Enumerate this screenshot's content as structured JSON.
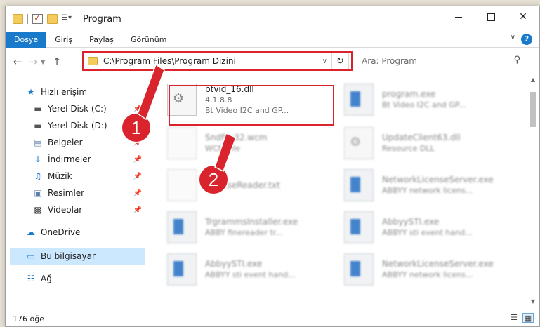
{
  "window": {
    "title": "Program",
    "controls": {
      "minimize": "",
      "maximize": "",
      "close": "✕"
    }
  },
  "ribbon": {
    "tabs": [
      "Dosya",
      "Giriş",
      "Paylaş",
      "Görünüm"
    ],
    "help": "?"
  },
  "address": {
    "path": "C:\\Program Files\\Program Dizini",
    "search_placeholder": "Ara: Program"
  },
  "navpane": {
    "items": [
      {
        "label": "Hızlı erişim",
        "icon": "star-icon",
        "pinned": false
      },
      {
        "label": "Yerel Disk (C:)",
        "icon": "drive-icon",
        "pinned": true
      },
      {
        "label": "Yerel Disk (D:)",
        "icon": "drive-icon",
        "pinned": false
      },
      {
        "label": "Belgeler",
        "icon": "documents-icon",
        "pinned": true
      },
      {
        "label": "İndirmeler",
        "icon": "download-icon",
        "pinned": true
      },
      {
        "label": "Müzik",
        "icon": "music-icon",
        "pinned": true
      },
      {
        "label": "Resimler",
        "icon": "pictures-icon",
        "pinned": true
      },
      {
        "label": "Videolar",
        "icon": "video-icon",
        "pinned": true
      },
      {
        "label": "OneDrive",
        "icon": "cloud-icon",
        "pinned": false
      },
      {
        "label": "Bu bilgisayar",
        "icon": "computer-icon",
        "pinned": false,
        "selected": true
      },
      {
        "label": "Ağ",
        "icon": "network-icon",
        "pinned": false
      }
    ]
  },
  "files": [
    {
      "name": "btvid_16.dll",
      "line2": "4.1.8.8",
      "line3": "Bt Video I2C and GP...",
      "type": "dll",
      "blurred": false
    },
    {
      "name": "program.exe",
      "line2": "Bt Video I2C and GP...",
      "line3": "",
      "type": "exe",
      "blurred": true
    },
    {
      "name": "Sndfile32.wcm",
      "line2": "WCM File",
      "line3": "",
      "type": "doc",
      "blurred": true
    },
    {
      "name": "UpdateClient63.dll",
      "line2": "Resource DLL",
      "line3": "",
      "type": "dll",
      "blurred": true
    },
    {
      "name": "LicenseReader.txt",
      "line2": "",
      "line3": "",
      "type": "doc",
      "blurred": true
    },
    {
      "name": "NetworkLicenseServer.exe",
      "line2": "ABBYY network licens...",
      "line3": "",
      "type": "exe",
      "blurred": true
    },
    {
      "name": "TrgrammsInstaller.exe",
      "line2": "ABBY finereader tr...",
      "line3": "",
      "type": "exe",
      "blurred": true
    },
    {
      "name": "AbbyySTI.exe",
      "line2": "ABBYY sti event hand...",
      "line3": "",
      "type": "exe",
      "blurred": true
    },
    {
      "name": "AbbyySTI.exe",
      "line2": "ABBYY sti event hand...",
      "line3": "",
      "type": "exe",
      "blurred": true
    },
    {
      "name": "NetworkLicenseServer.exe",
      "line2": "ABBYY network licens...",
      "line3": "",
      "type": "exe",
      "blurred": true
    }
  ],
  "callouts": [
    "1",
    "2"
  ],
  "status": {
    "count": "176 öğe"
  },
  "colors": {
    "accent": "#1979ca",
    "highlight": "#d9242d",
    "selected": "#cce8ff"
  }
}
